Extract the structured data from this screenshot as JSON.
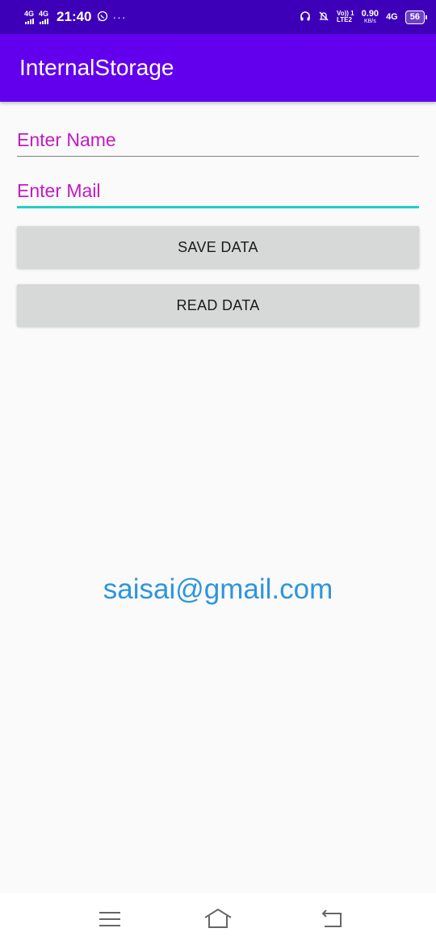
{
  "status_bar": {
    "network1": "4G",
    "network2": "4G",
    "time": "21:40",
    "more": "···",
    "volte_top": "Vo)) 1",
    "volte_bottom": "LTE2",
    "speed_value": "0.90",
    "speed_unit": "KB/s",
    "network3": "4G",
    "battery": "56",
    "icons": [
      "signal-icon",
      "whatsapp-icon",
      "headphones-icon",
      "mute-icon"
    ]
  },
  "app_bar": {
    "title": "InternalStorage"
  },
  "form": {
    "name_placeholder": "Enter Name",
    "mail_placeholder": "Enter Mail"
  },
  "buttons": {
    "save_label": "SAVE DATA",
    "read_label": "READ DATA"
  },
  "result": {
    "text": "saisai@gmail.com"
  },
  "nav": {
    "icons": [
      "menu-icon",
      "home-icon",
      "back-icon"
    ]
  },
  "colors": {
    "status_bar": "#3d00b8",
    "app_bar": "#6200ee",
    "hint": "#c21bc2",
    "focus_underline": "#1fd0c8",
    "result_text": "#2e95dc",
    "button": "#d7d8d8"
  }
}
